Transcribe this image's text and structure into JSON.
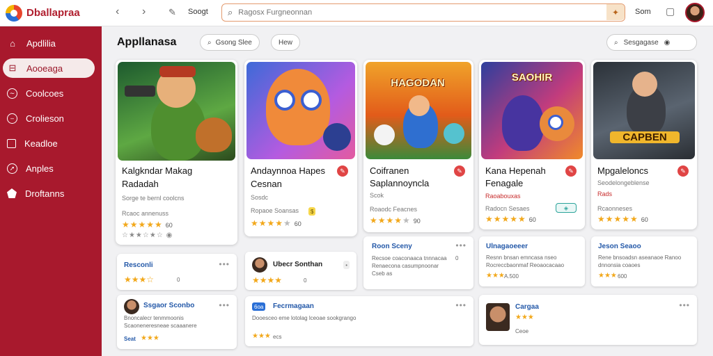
{
  "app": {
    "name": "Dballapraa"
  },
  "sidebar": {
    "items": [
      {
        "label": "Apdlilia",
        "icon": "home-icon"
      },
      {
        "label": "Aooeaga",
        "icon": "grid-icon",
        "active": true
      },
      {
        "label": "Coolcoes",
        "icon": "gamepad-icon"
      },
      {
        "label": "Crolieson",
        "icon": "circle-icon"
      },
      {
        "label": "Keadloe",
        "icon": "box-icon"
      },
      {
        "label": "Anples",
        "icon": "compass-icon"
      },
      {
        "label": "Droftanns",
        "icon": "pentagon-icon"
      }
    ]
  },
  "topbar": {
    "back": "‹",
    "forward": "›",
    "label": "Soogt",
    "search_placeholder": "Ragosx Furgneonnan",
    "right_label": "Som"
  },
  "header": {
    "title": "Appllanasa",
    "filter1": "Gsong Slee",
    "filter2": "Hew",
    "sort": "Sesgagase"
  },
  "games": [
    {
      "title1": "Kalgkndar Makag",
      "title2": "Radadah",
      "meta": "Sorge te bernl coolcns",
      "meta2": "Rcaoc annenuss",
      "rating": "60",
      "stars": 5
    },
    {
      "title1": "Andaynnoa Hapes",
      "title2": "Cesnan",
      "meta": "Sosdc",
      "meta2": "Ropaoe Soansas",
      "rating": "60",
      "stars": 4
    },
    {
      "title1": "Coifranen",
      "title2": "Saplannoyncla",
      "meta": "Scok",
      "meta2": "Roaodc Feacnes",
      "rating": "90",
      "stars": 4,
      "banner": "HAGODAN"
    },
    {
      "title1": "Kana Hepenah",
      "title2": "Fenagale",
      "meta": "Raoabouxas",
      "meta2": "Radocn Sesaes",
      "rating": "60",
      "stars": 4,
      "banner": "SAOHIR"
    },
    {
      "title1": "Mpgaleloncs",
      "title2": "",
      "meta": "Seodelongeblense",
      "meta2": "Rcaonneses",
      "rating": "60",
      "stars": 5,
      "banner": "CAPBEN",
      "metared": "Rads"
    }
  ],
  "small_cards": [
    {
      "title": "Resconli",
      "stars": "★★★☆",
      "num": "0"
    },
    {
      "title": "Ubecr Sonthan",
      "stars": "★★★★",
      "num": "0"
    },
    {
      "title": "Roon Sceny",
      "desc": "Recsoe coaconaaca tnnnacaa Renaecona casumpnoonar Cseb as",
      "num": "0"
    },
    {
      "title": "Ulnagaoeeer",
      "desc": "Resnn bnsan emncasa nseo Rocreccbaonmaf Reoaocacaao",
      "stars": "★★★",
      "label": "A.500"
    },
    {
      "title": "Jeson Seaoo",
      "desc": "Rene bnsoadsn aseanaoe Ranoo dnnonsia coaoes",
      "stars": "★★★",
      "label": "600"
    },
    {
      "title": "Ssgaor Sconbo",
      "desc": "Bnoncalecr tenmmoonis Scaoneneresneae scaaanere",
      "label": "Seat",
      "stars": "★★★"
    },
    {
      "title": "Fecrmagaan",
      "desc": "Dooesceo eme lotolag lceoae sookgrango",
      "tag": "6oa",
      "stars": "★★★",
      "label": "ecs"
    },
    {
      "title": "Cargaa",
      "stars": "★★★",
      "label": "Ceoe"
    }
  ]
}
